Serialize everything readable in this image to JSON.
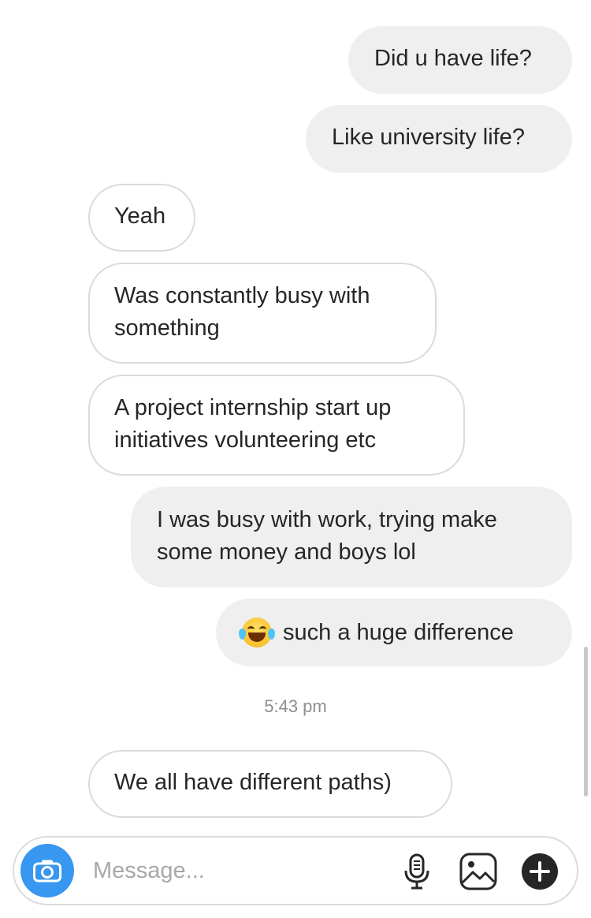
{
  "messages": [
    {
      "side": "out",
      "text": "Did u have life?"
    },
    {
      "side": "out",
      "text": "Like university life?"
    },
    {
      "side": "in",
      "text": "Yeah"
    },
    {
      "side": "in",
      "text": "Was constantly busy with\nsomething"
    },
    {
      "side": "in",
      "text": "A project internship start up\ninitiatives volunteering etc"
    },
    {
      "side": "out",
      "text": "I was busy with work, trying make\nsome money and boys lol"
    },
    {
      "side": "out",
      "emoji": "face-with-tears-of-joy",
      "text": "such a huge difference"
    },
    {
      "side": "in",
      "text": "We all have different paths)"
    }
  ],
  "timestamp": "5:43 pm",
  "composer": {
    "placeholder": "Message...",
    "icons": [
      "camera-icon",
      "microphone-icon",
      "gallery-icon",
      "plus-icon"
    ]
  },
  "colors": {
    "outgoing_bubble": "#efefef",
    "incoming_border": "#dbdbdb",
    "accent_blue": "#3897f0",
    "text": "#262626",
    "muted": "#8e8e8e"
  }
}
